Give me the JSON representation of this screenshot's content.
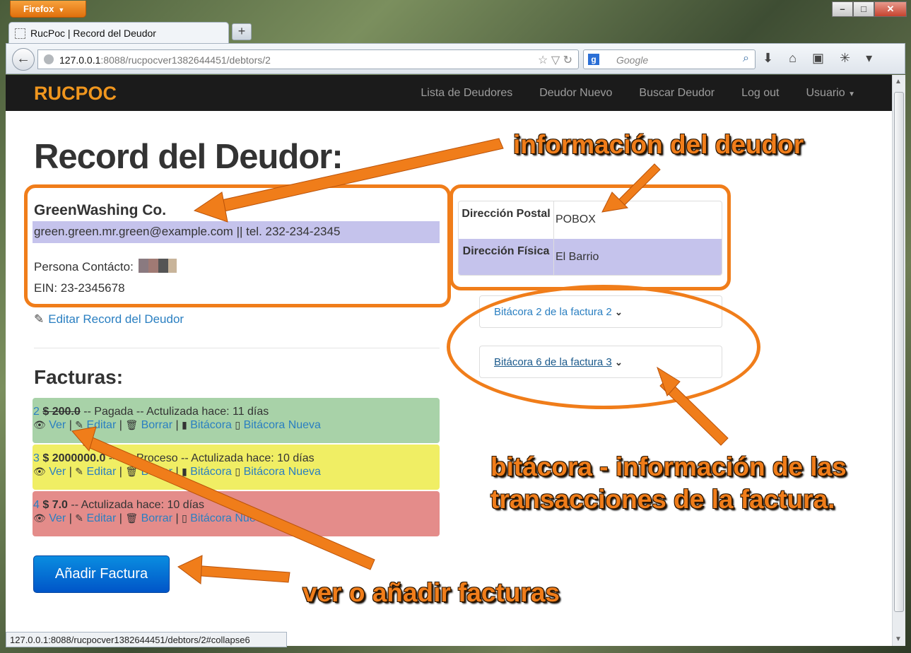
{
  "browser": {
    "menu_label": "Firefox",
    "tab_title": "RucPoc | Record del Deudor",
    "url_host": "127.0.0.1",
    "url_rest": ":8088/rucpocver1382644451/debtors/2",
    "search_placeholder": "Google",
    "status_url": "127.0.0.1:8088/rucpocver1382644451/debtors/2#collapse6"
  },
  "site_nav": {
    "brand": "RUCPOC",
    "links": [
      "Lista de Deudores",
      "Deudor Nuevo",
      "Buscar Deudor",
      "Log out",
      "Usuario"
    ]
  },
  "debtor": {
    "page_title": "Record del Deudor:",
    "name": "GreenWashing Co.",
    "contact_line": "green.green.mr.green@example.com || tel. 232-234-2345",
    "contact_person_label": "Persona Contácto:",
    "ein": "EIN: 23-2345678",
    "edit_link": "Editar Record del Deudor",
    "address": [
      {
        "label": "Dirección Postal",
        "value": "POBOX"
      },
      {
        "label": "Dirección Física",
        "value": "El Barrio"
      }
    ]
  },
  "invoices": {
    "title": "Facturas:",
    "items": [
      {
        "num": "2",
        "amount": "$ 200.0",
        "status": " -- Pagada -- Actulizada hace: 11 días",
        "color": "#a8d2a8"
      },
      {
        "num": "3",
        "amount": "$ 2000000.0",
        "status": " -- En Proceso -- Actulizada hace: 10 días",
        "color": "#f0ee64"
      },
      {
        "num": "4",
        "amount": "$ 7.0",
        "status": " -- Actulizada hace: 10 días",
        "color": "#e48c8a"
      }
    ],
    "actions": {
      "view": "Ver",
      "edit": "Editar",
      "delete": "Borrar",
      "log": "Bitácora",
      "new_log": "Bitácora Nueva"
    },
    "add_button": "Añadir Factura"
  },
  "logs": [
    "Bitácora 2 de la factura 2",
    "Bitácora 6 de la factura 3"
  ],
  "annotations": {
    "debtor_info": "información del deudor",
    "log_info_line1": "bitácora - información de las",
    "log_info_line2": "transacciones de la factura.",
    "invoices_info": "ver o añadir facturas"
  },
  "colors": {
    "accent": "#f07d1a",
    "brand": "#f0961e",
    "link": "#2a7fc1",
    "highlight": "#c5c3ec"
  }
}
